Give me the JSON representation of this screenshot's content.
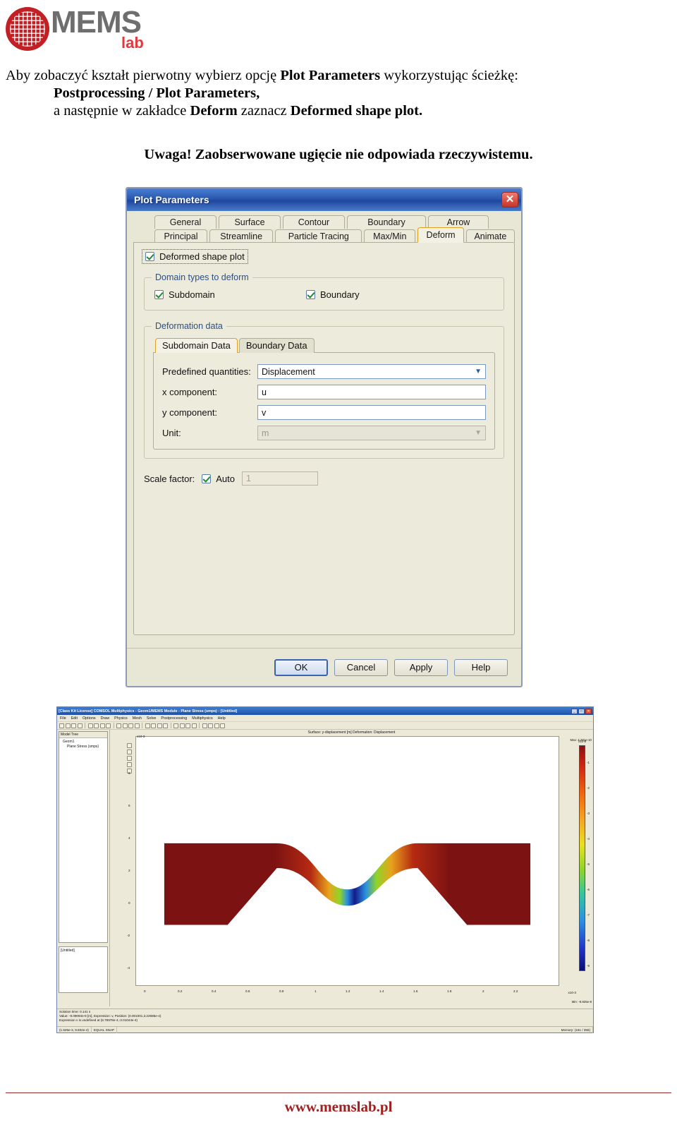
{
  "logo": {
    "brand": "MEMS",
    "sub": "lab"
  },
  "intro": {
    "line1_a": "Aby zobaczyć kształt pierwotny wybierz opcję ",
    "line1_b": "Plot Parameters",
    "line1_c": " wykorzystując ścieżkę:",
    "line2": "Postprocessing / Plot Parameters,",
    "line3_a": "a następnie w zakładce ",
    "line3_b": "Deform",
    "line3_c": " zaznacz ",
    "line3_d": "Deformed shape plot.",
    "note": "Uwaga! Zaobserwowane ugięcie nie odpowiada rzeczywistemu."
  },
  "dialog": {
    "title": "Plot Parameters",
    "close_icon": "✕",
    "tabs_row1": [
      "General",
      "Surface",
      "Contour",
      "Boundary",
      "Arrow"
    ],
    "tabs_row2": [
      "Principal",
      "Streamline",
      "Particle Tracing",
      "Max/Min",
      "Deform",
      "Animate"
    ],
    "active_tab": "Deform",
    "deformed_shape_plot": "Deformed shape plot",
    "domain_group_label": "Domain types to deform",
    "subdomain_label": "Subdomain",
    "boundary_label": "Boundary",
    "deformation_group_label": "Deformation data",
    "inner_tabs": [
      "Subdomain Data",
      "Boundary Data"
    ],
    "inner_active_tab": "Subdomain Data",
    "fields": [
      {
        "label": "Predefined quantities:",
        "value": "Displacement",
        "type": "select",
        "disabled": false
      },
      {
        "label": "x component:",
        "value": "u",
        "type": "input",
        "disabled": false
      },
      {
        "label": "y component:",
        "value": "v",
        "type": "input",
        "disabled": false
      },
      {
        "label": "Unit:",
        "value": "m",
        "type": "select",
        "disabled": true
      }
    ],
    "scale_factor_label": "Scale factor:",
    "auto_label": "Auto",
    "scale_factor_value": "1",
    "buttons": [
      "OK",
      "Cancel",
      "Apply",
      "Help"
    ]
  },
  "comsol": {
    "title": "[Class Kit License] COMSOL Multiphysics - Geom1/MEMS Module - Plane Stress (smps) : [Untitled]",
    "titlebar_buttons": [
      "_",
      "□",
      "✕"
    ],
    "menu": [
      "File",
      "Edit",
      "Options",
      "Draw",
      "Physics",
      "Mesh",
      "Solve",
      "Postprocessing",
      "Multiphysics",
      "Help"
    ],
    "tree_header": "Model Tree",
    "tree_items": [
      "Geom1",
      "Plane Stress (smps)"
    ],
    "untitled_panel": "[Untitled]",
    "plot_title": "Surface: y-displacement [m]  Deformation: Displacement",
    "status_lines": [
      "Solution time: 0.141 s",
      "Value: -9.09094e-8 [m], Expression: v, Position: (0.001001,3.22685e-4)",
      "Expression v is undefined at (8.78978e-4,-3.01044e-4)"
    ],
    "bottom_cells": [
      "(1.525e-3, 9.502e-4)",
      "EQUAL SNAP",
      "",
      "Memory: (151 / 356)"
    ],
    "colorbar": {
      "max_label": "Max: 4.281e-10",
      "min_label": "Min: -9.925e-8",
      "exponent_top": "x10-8",
      "ticks": [
        "-1",
        "-2",
        "-3",
        "-4",
        "-5",
        "-6",
        "-7",
        "-8",
        "-9"
      ]
    },
    "axes": {
      "y_exponent": "x10-3",
      "x_exponent": "x10-3",
      "y_ticks": [
        "8",
        "6",
        "4",
        "2",
        "0",
        "-2",
        "-4"
      ],
      "x_ticks": [
        "0",
        "0.2",
        "0.4",
        "0.6",
        "0.8",
        "1",
        "1.2",
        "1.4",
        "1.6",
        "1.8",
        "2",
        "2.2"
      ]
    }
  },
  "footer": {
    "url": "www.memslab.pl"
  }
}
